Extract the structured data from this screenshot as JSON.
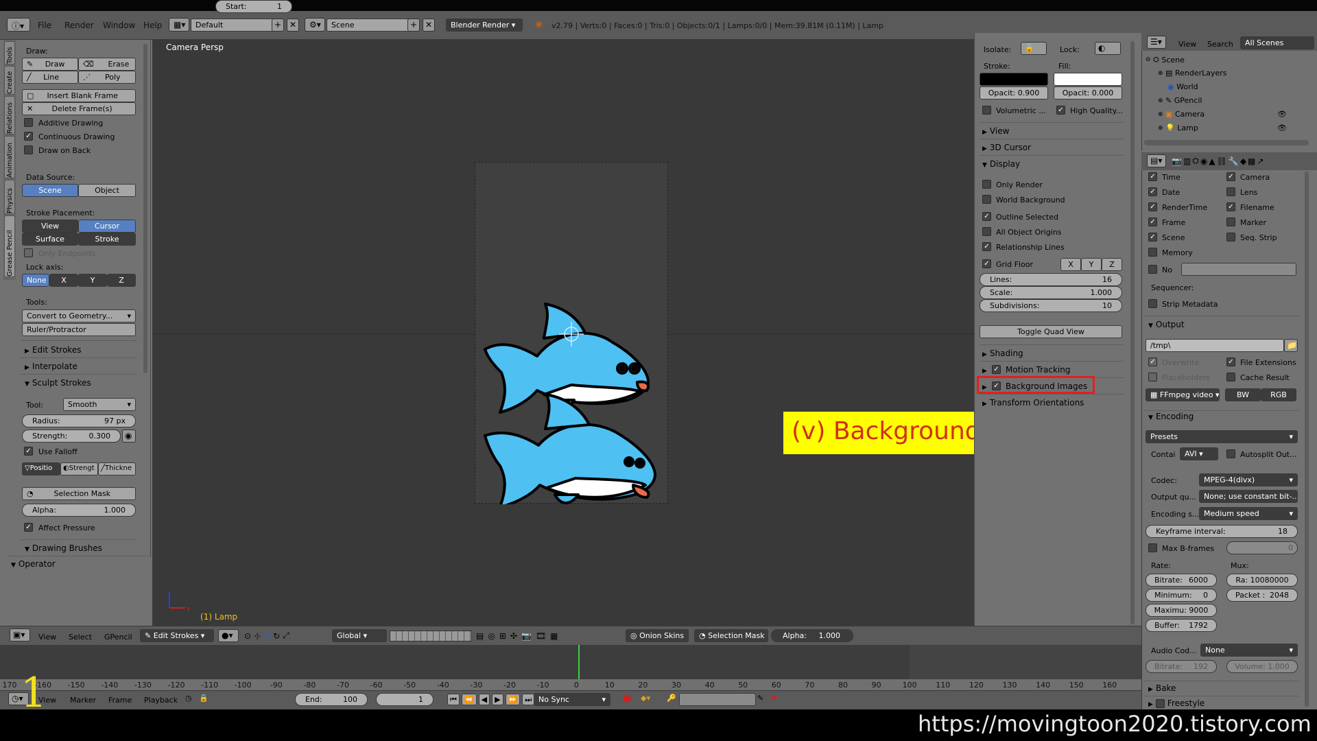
{
  "topbar": {
    "menus": [
      "File",
      "Render",
      "Window",
      "Help"
    ],
    "layout": "Default",
    "scene": "Scene",
    "engine": "Blender Render",
    "stats": "v2.79 | Verts:0 | Faces:0 | Tris:0 | Objects:0/1 | Lamps:0/0 | Mem:39.81M (0.11M) | Lamp"
  },
  "tool_tabs": [
    "Tools",
    "Create",
    "Relations",
    "Animation",
    "Physics",
    "Grease Pencil"
  ],
  "tools": {
    "draw_label": "Draw:",
    "draw": "Draw",
    "erase": "Erase",
    "line": "Line",
    "poly": "Poly",
    "insert_blank": "Insert Blank Frame",
    "delete_frames": "Delete Frame(s)",
    "additive": "Additive Drawing",
    "continuous": "Continuous Drawing",
    "draw_on_back": "Draw on Back",
    "data_source_label": "Data Source:",
    "ds_scene": "Scene",
    "ds_object": "Object",
    "stroke_placement_label": "Stroke Placement:",
    "sp_view": "View",
    "sp_cursor": "Cursor",
    "sp_surface": "Surface",
    "sp_stroke": "Stroke",
    "only_endpoints": "Only Endpoints",
    "lock_axis_label": "Lock axis:",
    "axes": [
      "None",
      "X",
      "Y",
      "Z"
    ],
    "tools_label": "Tools:",
    "convert": "Convert to Geometry...",
    "ruler": "Ruler/Protractor",
    "edit_strokes": "Edit Strokes",
    "interpolate": "Interpolate",
    "sculpt_strokes": "Sculpt Strokes",
    "tool_label": "Tool:",
    "tool_value": "Smooth",
    "radius_label": "Radius:",
    "radius_value": "97 px",
    "strength_label": "Strength:",
    "strength_value": "0.300",
    "use_falloff": "Use Falloff",
    "positio": "Positio",
    "strengt": "Strengt",
    "thickne": "Thickne",
    "selection_mask": "Selection Mask",
    "alpha_label": "Alpha:",
    "alpha_value": "1.000",
    "affect_pressure": "Affect Pressure",
    "drawing_brushes": "Drawing Brushes",
    "operator": "Operator"
  },
  "viewport": {
    "view_name": "Camera Persp",
    "object_label": "(1) Lamp",
    "annotation": "(v) Background images"
  },
  "viewport_header": {
    "menus": [
      "View",
      "Select",
      "GPencil"
    ],
    "mode": "Edit Strokes",
    "orientation": "Global",
    "onion": "Onion Skins",
    "selmask": "Selection Mask",
    "alpha_label": "Alpha:",
    "alpha_value": "1.000"
  },
  "npanel": {
    "isolate": "Isolate:",
    "lock": "Lock:",
    "stroke": "Stroke:",
    "fill": "Fill:",
    "stroke_opacity": "Opacit: 0.900",
    "fill_opacity": "Opacit: 0.000",
    "volumetric": "Volumetric ...",
    "high_quality": "High Quality...",
    "view": "View",
    "cursor": "3D Cursor",
    "display": "Display",
    "only_render": "Only Render",
    "world_bg": "World Background",
    "outline_selected": "Outline Selected",
    "all_origins": "All Object Origins",
    "relationship_lines": "Relationship Lines",
    "grid_floor": "Grid Floor",
    "gx": "X",
    "gy": "Y",
    "gz": "Z",
    "lines_label": "Lines:",
    "lines_value": "16",
    "scale_label": "Scale:",
    "scale_value": "1.000",
    "subdiv_label": "Subdivisions:",
    "subdiv_value": "10",
    "toggle_quad": "Toggle Quad View",
    "shading": "Shading",
    "motion_tracking": "Motion Tracking",
    "background_images": "Background Images",
    "transform_orient": "Transform Orientations"
  },
  "outliner": {
    "view": "View",
    "search": "Search",
    "filter": "All Scenes",
    "items": [
      "Scene",
      "RenderLayers",
      "World",
      "GPencil",
      "Camera",
      "Lamp"
    ]
  },
  "properties": {
    "time": "Time",
    "camera": "Camera",
    "date": "Date",
    "lens": "Lens",
    "rendertime": "RenderTime",
    "filename": "Filename",
    "frame": "Frame",
    "marker": "Marker",
    "scene": "Scene",
    "seqstrip": "Seq. Strip",
    "memory": "Memory",
    "no": "No",
    "sequencer": "Sequencer:",
    "strip_metadata": "Strip Metadata",
    "output": "Output",
    "path": "/tmp\\",
    "overwrite": "Overwrite",
    "file_ext": "File Extensions",
    "placeholders": "Placeholders",
    "cache_result": "Cache Result",
    "ffmpeg": "FFmpeg video",
    "bw": "BW",
    "rgb": "RGB",
    "encoding": "Encoding",
    "presets": "Presets",
    "container_label": "Contai",
    "container_value": "AVI",
    "autosplit": "Autosplit Out...",
    "codec_label": "Codec:",
    "codec_value": "MPEG-4(divx)",
    "output_q_label": "Output qu...",
    "output_q_value": "None; use constant bit-...",
    "enc_speed_label": "Encoding s...",
    "enc_speed_value": "Medium speed",
    "keyframe": "Keyframe interval:",
    "keyframe_value": "18",
    "max_bframes": "Max B-frames",
    "bframes_value": "0",
    "rate": "Rate:",
    "mux": "Mux:",
    "bitrate": "Bitrate:",
    "bitrate_value": "6000",
    "ra": "Ra: 10080000",
    "minimum": "Minimum:",
    "minimum_value": "0",
    "packet": "Packet :",
    "packet_value": "2048",
    "maximum": "Maximu: 9000",
    "buffer": "Buffer:",
    "buffer_value": "1792",
    "audio_codec": "Audio Cod...",
    "audio_value": "None",
    "a_bitrate": "Bitrate:",
    "a_bitrate_value": "192",
    "volume": "Volume: 1.000",
    "bake": "Bake",
    "freestyle": "Freestyle"
  },
  "timeline": {
    "ticks": [
      "170",
      "-160",
      "-150",
      "-140",
      "-130",
      "-120",
      "-110",
      "-100",
      "-90",
      "-80",
      "-70",
      "-60",
      "-50",
      "-40",
      "-30",
      "-20",
      "-10",
      "0",
      "10",
      "20",
      "30",
      "40",
      "50",
      "60",
      "70",
      "80",
      "90",
      "100",
      "110",
      "120",
      "130",
      "140",
      "150",
      "160"
    ],
    "menus": [
      "View",
      "Marker",
      "Frame",
      "Playback"
    ],
    "start_label": "Start:",
    "start_value": "1",
    "end_label": "End:",
    "end_value": "100",
    "current": "1",
    "sync": "No Sync"
  },
  "overlay": {
    "step_number": "1",
    "watermark": "https://movingtoon2020.tistory.com"
  }
}
